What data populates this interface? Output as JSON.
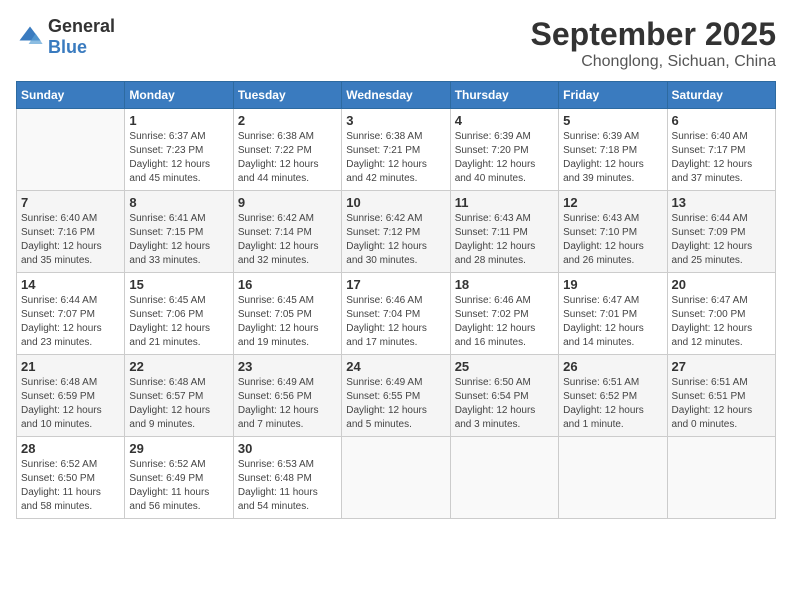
{
  "header": {
    "logo_general": "General",
    "logo_blue": "Blue",
    "main_title": "September 2025",
    "sub_title": "Chonglong, Sichuan, China"
  },
  "days_of_week": [
    "Sunday",
    "Monday",
    "Tuesday",
    "Wednesday",
    "Thursday",
    "Friday",
    "Saturday"
  ],
  "weeks": [
    [
      {
        "day": "",
        "info": ""
      },
      {
        "day": "1",
        "info": "Sunrise: 6:37 AM\nSunset: 7:23 PM\nDaylight: 12 hours\nand 45 minutes."
      },
      {
        "day": "2",
        "info": "Sunrise: 6:38 AM\nSunset: 7:22 PM\nDaylight: 12 hours\nand 44 minutes."
      },
      {
        "day": "3",
        "info": "Sunrise: 6:38 AM\nSunset: 7:21 PM\nDaylight: 12 hours\nand 42 minutes."
      },
      {
        "day": "4",
        "info": "Sunrise: 6:39 AM\nSunset: 7:20 PM\nDaylight: 12 hours\nand 40 minutes."
      },
      {
        "day": "5",
        "info": "Sunrise: 6:39 AM\nSunset: 7:18 PM\nDaylight: 12 hours\nand 39 minutes."
      },
      {
        "day": "6",
        "info": "Sunrise: 6:40 AM\nSunset: 7:17 PM\nDaylight: 12 hours\nand 37 minutes."
      }
    ],
    [
      {
        "day": "7",
        "info": "Sunrise: 6:40 AM\nSunset: 7:16 PM\nDaylight: 12 hours\nand 35 minutes."
      },
      {
        "day": "8",
        "info": "Sunrise: 6:41 AM\nSunset: 7:15 PM\nDaylight: 12 hours\nand 33 minutes."
      },
      {
        "day": "9",
        "info": "Sunrise: 6:42 AM\nSunset: 7:14 PM\nDaylight: 12 hours\nand 32 minutes."
      },
      {
        "day": "10",
        "info": "Sunrise: 6:42 AM\nSunset: 7:12 PM\nDaylight: 12 hours\nand 30 minutes."
      },
      {
        "day": "11",
        "info": "Sunrise: 6:43 AM\nSunset: 7:11 PM\nDaylight: 12 hours\nand 28 minutes."
      },
      {
        "day": "12",
        "info": "Sunrise: 6:43 AM\nSunset: 7:10 PM\nDaylight: 12 hours\nand 26 minutes."
      },
      {
        "day": "13",
        "info": "Sunrise: 6:44 AM\nSunset: 7:09 PM\nDaylight: 12 hours\nand 25 minutes."
      }
    ],
    [
      {
        "day": "14",
        "info": "Sunrise: 6:44 AM\nSunset: 7:07 PM\nDaylight: 12 hours\nand 23 minutes."
      },
      {
        "day": "15",
        "info": "Sunrise: 6:45 AM\nSunset: 7:06 PM\nDaylight: 12 hours\nand 21 minutes."
      },
      {
        "day": "16",
        "info": "Sunrise: 6:45 AM\nSunset: 7:05 PM\nDaylight: 12 hours\nand 19 minutes."
      },
      {
        "day": "17",
        "info": "Sunrise: 6:46 AM\nSunset: 7:04 PM\nDaylight: 12 hours\nand 17 minutes."
      },
      {
        "day": "18",
        "info": "Sunrise: 6:46 AM\nSunset: 7:02 PM\nDaylight: 12 hours\nand 16 minutes."
      },
      {
        "day": "19",
        "info": "Sunrise: 6:47 AM\nSunset: 7:01 PM\nDaylight: 12 hours\nand 14 minutes."
      },
      {
        "day": "20",
        "info": "Sunrise: 6:47 AM\nSunset: 7:00 PM\nDaylight: 12 hours\nand 12 minutes."
      }
    ],
    [
      {
        "day": "21",
        "info": "Sunrise: 6:48 AM\nSunset: 6:59 PM\nDaylight: 12 hours\nand 10 minutes."
      },
      {
        "day": "22",
        "info": "Sunrise: 6:48 AM\nSunset: 6:57 PM\nDaylight: 12 hours\nand 9 minutes."
      },
      {
        "day": "23",
        "info": "Sunrise: 6:49 AM\nSunset: 6:56 PM\nDaylight: 12 hours\nand 7 minutes."
      },
      {
        "day": "24",
        "info": "Sunrise: 6:49 AM\nSunset: 6:55 PM\nDaylight: 12 hours\nand 5 minutes."
      },
      {
        "day": "25",
        "info": "Sunrise: 6:50 AM\nSunset: 6:54 PM\nDaylight: 12 hours\nand 3 minutes."
      },
      {
        "day": "26",
        "info": "Sunrise: 6:51 AM\nSunset: 6:52 PM\nDaylight: 12 hours\nand 1 minute."
      },
      {
        "day": "27",
        "info": "Sunrise: 6:51 AM\nSunset: 6:51 PM\nDaylight: 12 hours\nand 0 minutes."
      }
    ],
    [
      {
        "day": "28",
        "info": "Sunrise: 6:52 AM\nSunset: 6:50 PM\nDaylight: 11 hours\nand 58 minutes."
      },
      {
        "day": "29",
        "info": "Sunrise: 6:52 AM\nSunset: 6:49 PM\nDaylight: 11 hours\nand 56 minutes."
      },
      {
        "day": "30",
        "info": "Sunrise: 6:53 AM\nSunset: 6:48 PM\nDaylight: 11 hours\nand 54 minutes."
      },
      {
        "day": "",
        "info": ""
      },
      {
        "day": "",
        "info": ""
      },
      {
        "day": "",
        "info": ""
      },
      {
        "day": "",
        "info": ""
      }
    ]
  ]
}
